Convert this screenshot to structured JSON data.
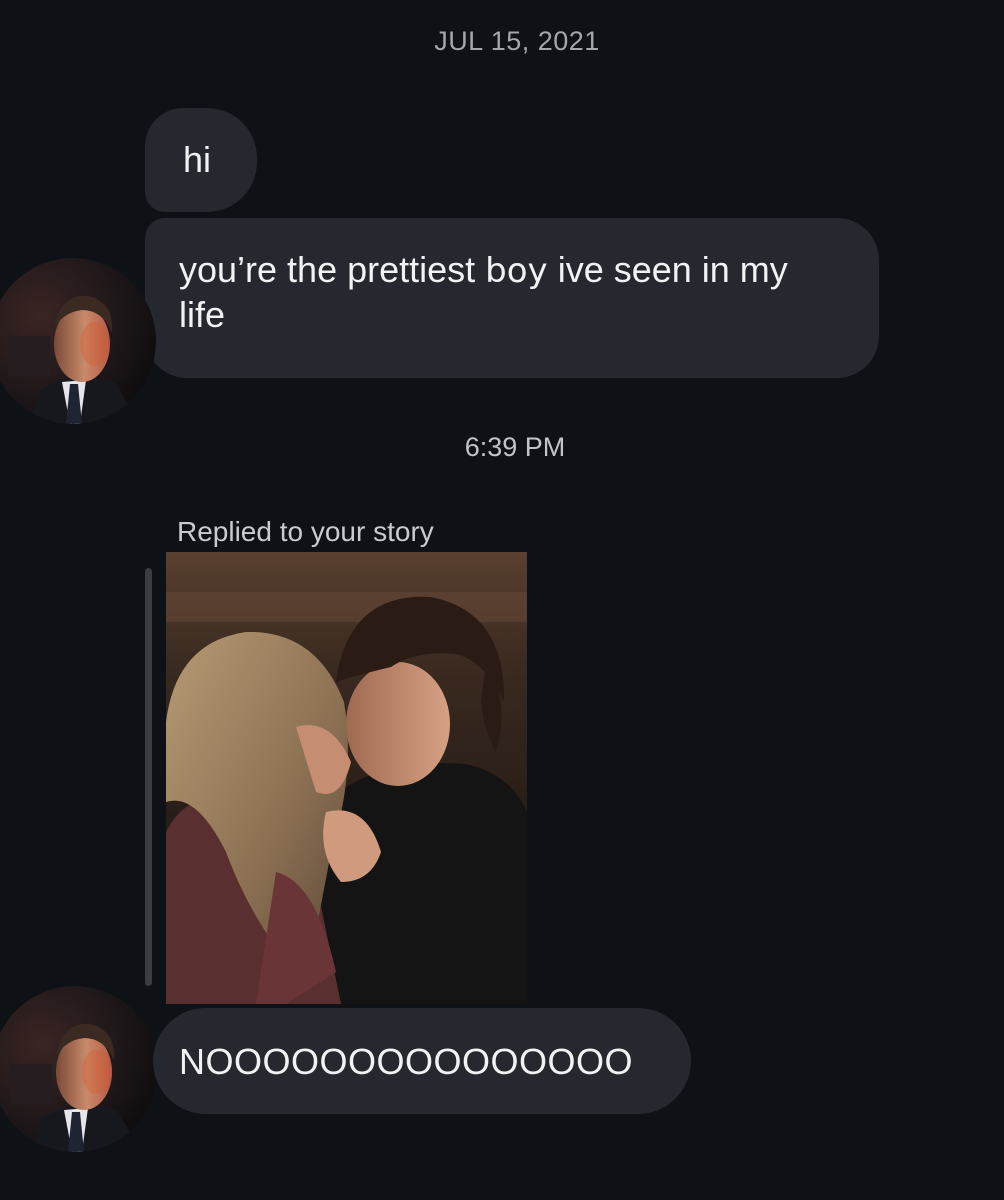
{
  "thread": {
    "date_stamp": "JUL 15, 2021",
    "time_stamp": "6:39 PM"
  },
  "messages": [
    {
      "text": "hi"
    },
    {
      "text_before": "you’re the prettiest ",
      "text_highlight": "boy",
      "text_after": " ive seen in my life"
    },
    {
      "reply_label": "Replied to your story"
    },
    {
      "text": "NOOOOOOOOOOOOOOO"
    }
  ],
  "colors": {
    "background": "#0e1116",
    "bubble": "#25282e",
    "timestamp": "#a3a6ad"
  },
  "icons": {
    "avatar": "profile-photo",
    "story": "story-thumbnail"
  }
}
